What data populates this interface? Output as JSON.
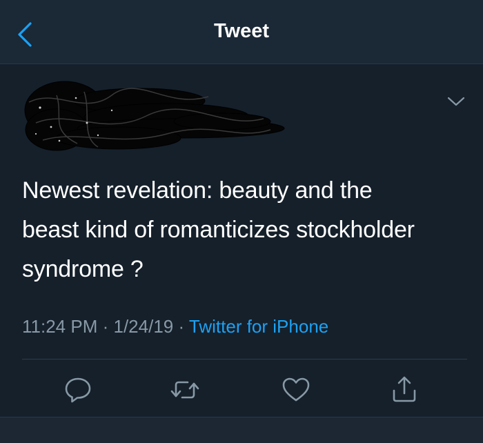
{
  "header": {
    "title": "Tweet",
    "back_icon": "chevron-left-icon"
  },
  "tweet": {
    "author_redacted": true,
    "text": "Newest revelation: beauty and the\nbeast kind of romanticizes stockholder\nsyndrome ?",
    "time": "11:24 PM",
    "separator": "·",
    "date": "1/24/19",
    "source": "Twitter for iPhone",
    "menu_icon": "chevron-down-icon"
  },
  "actions": [
    {
      "name": "reply",
      "icon": "reply-icon"
    },
    {
      "name": "retweet",
      "icon": "retweet-icon"
    },
    {
      "name": "like",
      "icon": "heart-icon"
    },
    {
      "name": "share",
      "icon": "share-icon"
    }
  ],
  "colors": {
    "background": "#15202b",
    "nav_background": "#1b2836",
    "accent": "#1da1f2",
    "muted_text": "#8899a6",
    "icon": "#8899a6"
  }
}
